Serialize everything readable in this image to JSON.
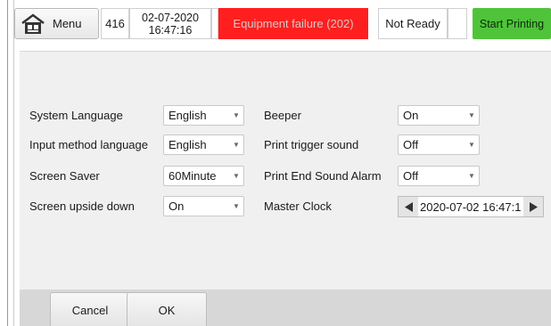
{
  "topbar": {
    "menu_label": "Menu",
    "counter": "416",
    "date": "02-07-2020",
    "time": "16:47:16",
    "alarm_text": "Equipment failure (202)",
    "status_text": "Not Ready",
    "start_label": "Start Printing"
  },
  "settings": {
    "system_language": {
      "label": "System Language",
      "value": "English"
    },
    "input_method_language": {
      "label": "Input method language",
      "value": "English"
    },
    "screen_saver": {
      "label": "Screen Saver",
      "value": "60Minute"
    },
    "screen_upside_down": {
      "label": "Screen upside down",
      "value": "On"
    },
    "beeper": {
      "label": "Beeper",
      "value": "On"
    },
    "print_trigger_sound": {
      "label": "Print trigger sound",
      "value": "Off"
    },
    "print_end_sound_alarm": {
      "label": "Print End Sound Alarm",
      "value": "Off"
    },
    "master_clock": {
      "label": "Master Clock",
      "value": "2020-07-02 16:47:1"
    }
  },
  "footer": {
    "cancel_label": "Cancel",
    "ok_label": "OK"
  },
  "colors": {
    "alarm_bg": "#ff1f1f",
    "start_bg": "#4fc43a",
    "content_bg": "#f0f0f0"
  },
  "icons": {
    "menu": "home-icon",
    "select_arrow": "chevron-down-icon",
    "clock_prev": "triangle-left-icon",
    "clock_next": "triangle-right-icon"
  }
}
